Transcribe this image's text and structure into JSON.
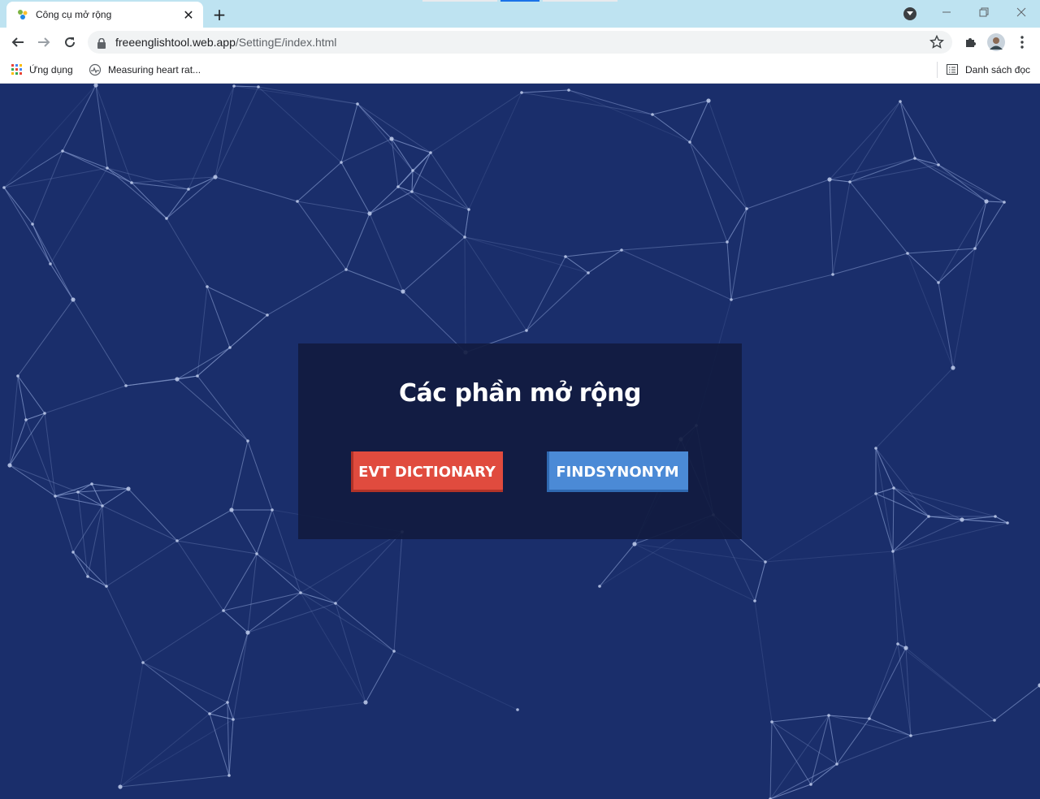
{
  "browser": {
    "tab_title": "Công cụ mở rộng",
    "tab_close": "✕",
    "new_tab": "+",
    "url_host": "freeenglishtool.web.app",
    "url_path": "/SettingE/index.html",
    "bookmarks": [
      {
        "label": "Ứng dụng",
        "icon": "apps-grid-icon"
      },
      {
        "label": "Measuring heart rat...",
        "icon": "heart-rate-icon"
      }
    ],
    "reading_list": "Danh sách đọc"
  },
  "page": {
    "title": "Các phần mở rộng",
    "buttons": {
      "dictionary": "EVT DICTIONARY",
      "synonym": "FINDSYNONYM"
    }
  },
  "colors": {
    "background": "#1a2e6b",
    "panel": "#111b40",
    "red_button": "#e04b3e",
    "blue_button": "#4b8ad6"
  }
}
